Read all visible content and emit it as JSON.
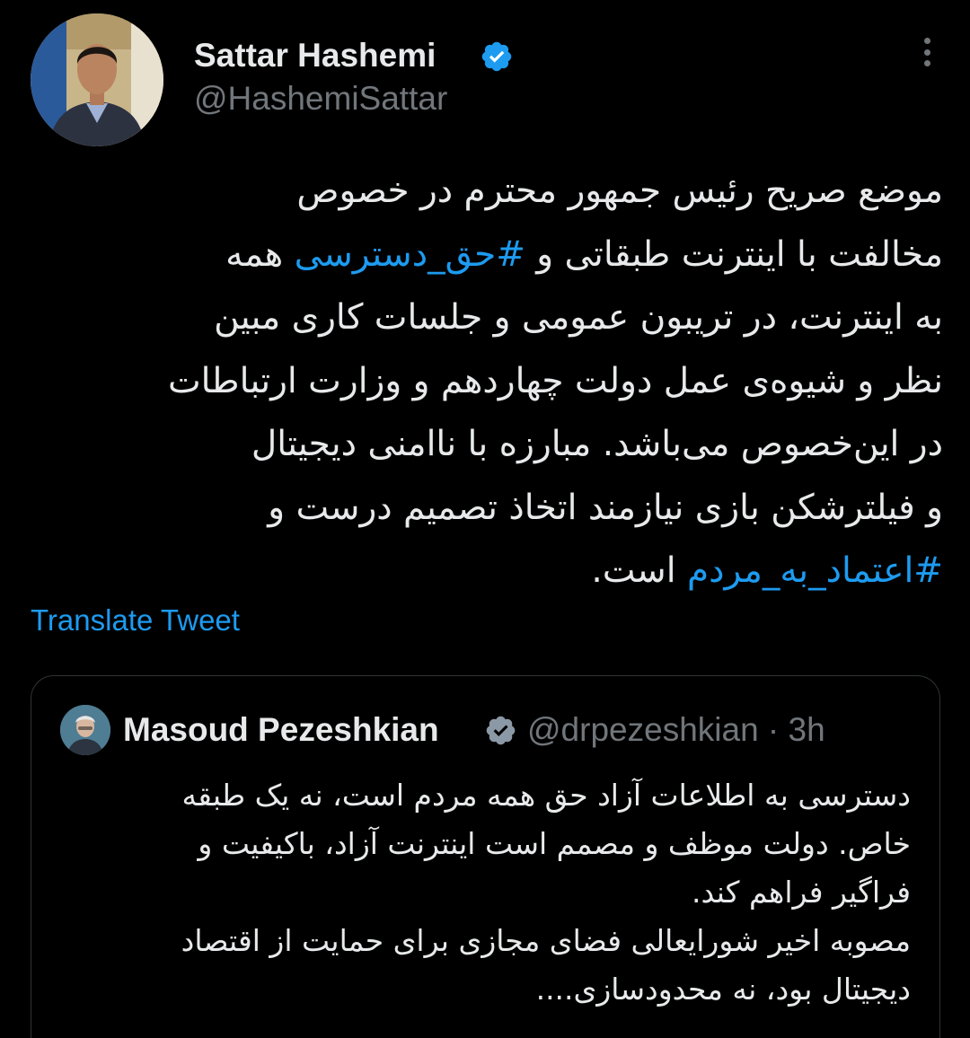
{
  "author": {
    "display_name": "Sattar Hashemi",
    "handle": "@HashemiSattar",
    "verified": true
  },
  "tweet": {
    "lines": [
      [
        {
          "text": "موضع صریح رئیس جمهور محترم در خصوص",
          "hashtag": false
        }
      ],
      [
        {
          "text": "مخالفت با اینترنت طبقاتی و ",
          "hashtag": false
        },
        {
          "text": "#حق_دسترسی",
          "hashtag": true
        },
        {
          "text": " همه",
          "hashtag": false
        }
      ],
      [
        {
          "text": "به اینترنت، در تریبون عمومی و جلسات کاری مبین",
          "hashtag": false
        }
      ],
      [
        {
          "text": "نظر و شیوه‌ی عمل دولت چهاردهم و وزارت ارتباطات",
          "hashtag": false
        }
      ],
      [
        {
          "text": "در این‌خصوص می‌باشد. مبارزه با ناامنی دیجیتال",
          "hashtag": false
        }
      ],
      [
        {
          "text": "و فیلترشکن بازی نیازمند اتخاذ تصمیم درست و",
          "hashtag": false
        }
      ],
      [
        {
          "text": "#اعتماد_به_مردم",
          "hashtag": true
        },
        {
          "text": " است.",
          "hashtag": false
        }
      ]
    ],
    "translate_label": "Translate Tweet"
  },
  "quoted_tweet": {
    "display_name": "Masoud Pezeshkian",
    "handle_time": "@drpezeshkian · 3h",
    "verified": true,
    "lines": [
      "دسترسی به اطلاعات آزاد حق همه مردم است، نه یک طبقه",
      "خاص. دولت موظف و مصمم است اینترنت آزاد، باکیفیت و",
      "فراگیر فراهم کند.",
      "مصوبه اخیر شورایعالی فضای مجازی برای حمایت از اقتصاد",
      "دیجیتال بود، نه محدودسازی...."
    ]
  },
  "icons": {
    "verified": "verified-badge-icon",
    "more": "more-options-icon"
  },
  "colors": {
    "background": "#000000",
    "text": "#e7e9ea",
    "secondary": "#71767b",
    "link": "#1d9bf0",
    "border": "#2f3336"
  }
}
